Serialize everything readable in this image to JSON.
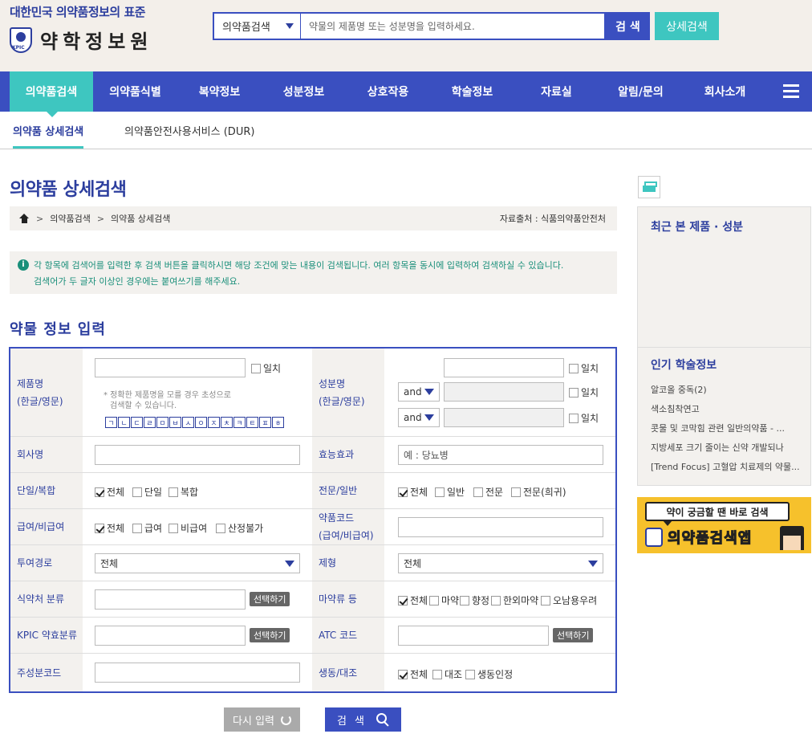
{
  "header": {
    "tagline": "대한민국 의약품정보의 표준",
    "logo_text": "약학정보원",
    "logo_mark": "KPIC",
    "search_select": "의약품검색",
    "search_placeholder": "약물의 제품명 또는 성분명을 입력하세요.",
    "search_button": "검 색",
    "advanced_button": "상세검색"
  },
  "nav": {
    "items": [
      "의약품검색",
      "의약품식별",
      "복약정보",
      "성분정보",
      "상호작용",
      "학술정보",
      "자료실",
      "알림/문의",
      "회사소개"
    ],
    "active_index": 0
  },
  "subnav": {
    "items": [
      "의약품 상세검색",
      "의약품안전사용서비스 (DUR)"
    ]
  },
  "page": {
    "title": "의약품 상세검색",
    "breadcrumb": [
      "의약품검색",
      "의약품 상세검색"
    ],
    "source": "자료출처 : 식품의약품안전처",
    "notice_line1": "각 항목에 검색어를 입력한 후 검색 버튼을 클릭하시면 해당 조건에 맞는 내용이 검색됩니다. 여러 항목을 동시에 입력하여 검색하실 수 있습니다.",
    "notice_line2": "검색어가 두 글자 이상인 경우에는 붙여쓰기를 해주세요.",
    "section_title": "약물 정보 입력"
  },
  "form": {
    "product_label_1": "제품명",
    "product_label_2": "(한글/영문)",
    "exact": "일치",
    "product_hint_1": "* 정확한 제품명을 모를 경우 초성으로",
    "product_hint_2": "검색할 수 있습니다.",
    "jamo": [
      "ㄱ",
      "ㄴ",
      "ㄷ",
      "ㄹ",
      "ㅁ",
      "ㅂ",
      "ㅅ",
      "ㅇ",
      "ㅈ",
      "ㅊ",
      "ㅋ",
      "ㅌ",
      "ㅍ",
      "ㅎ"
    ],
    "ingredient_label_1": "성분명",
    "ingredient_label_2": "(한글/영문)",
    "and_op": "and",
    "company_label": "회사명",
    "efficacy_label": "효능효과",
    "efficacy_placeholder": "예 : 당뇨병",
    "single_label": "단일/복합",
    "single_opts": [
      "전체",
      "단일",
      "복합"
    ],
    "pro_label": "전문/일반",
    "pro_opts": [
      "전체",
      "일반",
      "전문",
      "전문(희귀)"
    ],
    "pay_label": "급여/비급여",
    "pay_opts": [
      "전체",
      "급여",
      "비급여",
      "산정불가"
    ],
    "code_label_1": "약품코드",
    "code_label_2": "(급여/비급여)",
    "route_label": "투여경로",
    "route_value": "전체",
    "form_label": "제형",
    "form_value": "전체",
    "mfds_label": "식약처 분류",
    "pick": "선택하기",
    "narcotic_label": "마약류 등",
    "narcotic_opts": [
      "전체",
      "마약",
      "향정",
      "한외마약",
      "오남용우려"
    ],
    "kpic_label": "KPIC 약효분류",
    "atc_label": "ATC 코드",
    "main_code_label": "주성분코드",
    "bioeq_label": "생동/대조",
    "bioeq_opts": [
      "전체",
      "대조",
      "생동인정"
    ]
  },
  "buttons": {
    "reset": "다시 입력",
    "search": "검 색"
  },
  "side": {
    "recent_title": "최근 본 제품 · 성분",
    "popular_title": "인기 학술정보",
    "popular": [
      "알코올 중독(2)",
      "색소침착연고",
      "콧물 및 코막힘 관련 일반의약품 - ...",
      "지방세포 크기 줄이는 신약 개발되나",
      "[Trend Focus] 고혈압 치료제의 약물..."
    ],
    "banner_bubble": "약이 궁금할 땐 바로 검색",
    "banner_text": "의약품검색앱"
  }
}
